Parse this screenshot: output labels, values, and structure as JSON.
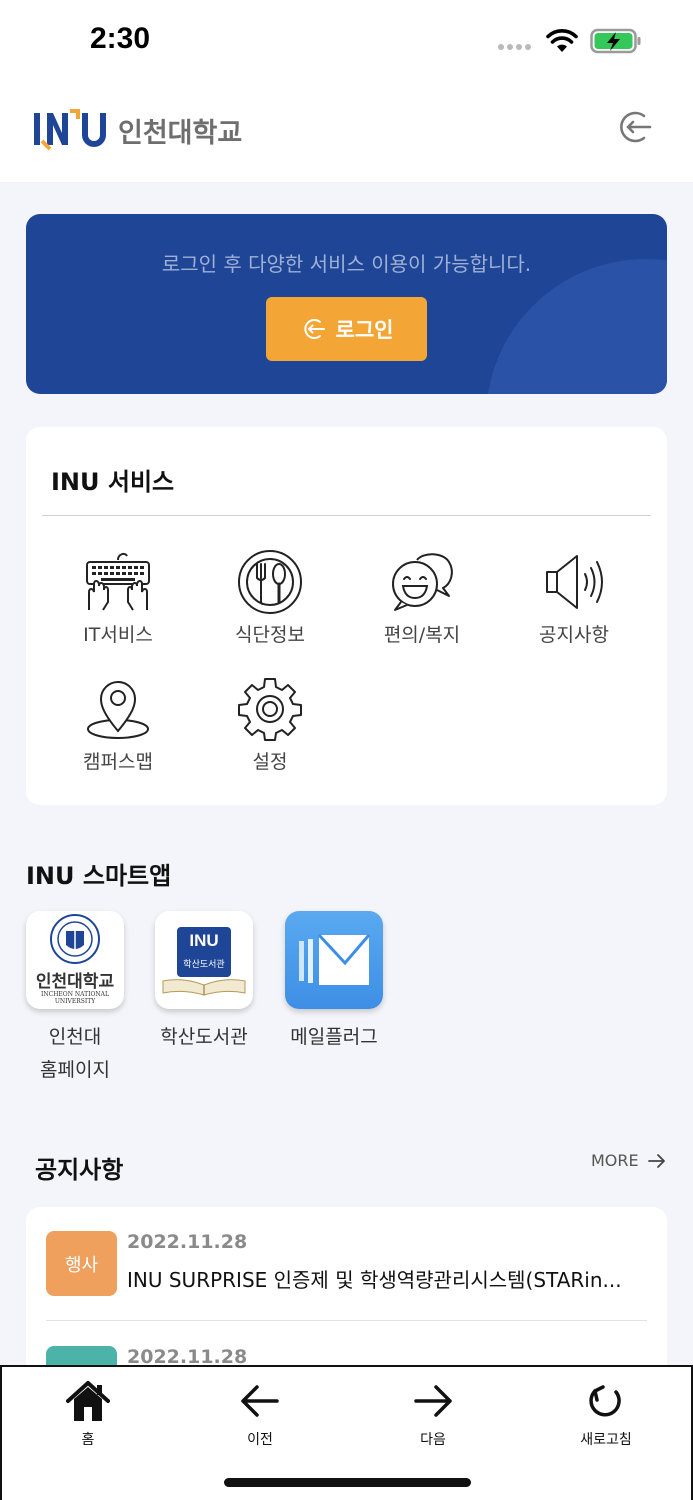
{
  "status_bar": {
    "time": "2:30"
  },
  "header": {
    "logo_mark": "INU",
    "logo_text": "인천대학교"
  },
  "login_banner": {
    "message": "로그인 후 다양한 서비스 이용이 가능합니다.",
    "button_label": "로그인"
  },
  "services": {
    "title": "INU 서비스",
    "items": [
      {
        "label": "IT서비스",
        "icon": "keyboard-hands-icon"
      },
      {
        "label": "식단정보",
        "icon": "dish-icon"
      },
      {
        "label": "편의/복지",
        "icon": "chat-smile-icon"
      },
      {
        "label": "공지사항",
        "icon": "speaker-icon"
      },
      {
        "label": "캠퍼스맵",
        "icon": "map-pin-icon"
      },
      {
        "label": "설정",
        "icon": "gear-icon"
      }
    ]
  },
  "smart_apps": {
    "title": "INU 스마트앱",
    "apps": [
      {
        "label_line1": "인천대",
        "label_line2": "홈페이지",
        "icon_text": "인천대학교",
        "icon_subtext": "INCHEON NATIONAL UNIVERSITY"
      },
      {
        "label_line1": "학산도서관",
        "icon_text": "INU",
        "icon_subtext": "학산도서관"
      },
      {
        "label_line1": "메일플러그",
        "icon": "mail-icon"
      }
    ]
  },
  "notices": {
    "title": "공지사항",
    "more_label": "MORE",
    "items": [
      {
        "badge": "행사",
        "badge_color": "#eea05c",
        "date": "2022.11.28",
        "text": "INU SURPRISE 인증제 및 학생역량관리시스템(STARin..."
      },
      {
        "badge": "",
        "badge_color": "#4bb3a8",
        "date": "2022.11.28",
        "text": ""
      }
    ]
  },
  "bottom_nav": {
    "items": [
      {
        "label": "홈",
        "icon": "home-icon"
      },
      {
        "label": "이전",
        "icon": "arrow-left-icon"
      },
      {
        "label": "다음",
        "icon": "arrow-right-icon"
      },
      {
        "label": "새로고침",
        "icon": "refresh-icon"
      }
    ]
  },
  "colors": {
    "brand_blue": "#1f4696",
    "login_button": "#f3a636",
    "background": "#f3f5fa"
  }
}
